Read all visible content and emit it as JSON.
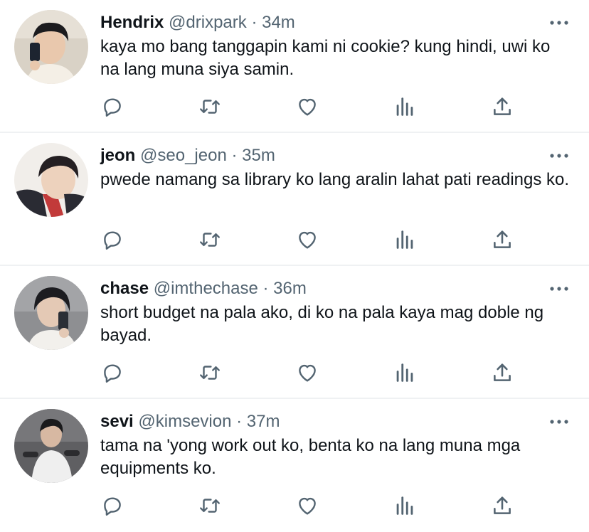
{
  "tweets": [
    {
      "name": "Hendrix",
      "handle": "@drixpark",
      "separator": "·",
      "time": "34m",
      "text": "kaya mo bang tanggapin kami ni cookie? kung hindi, uwi ko na lang muna siya samin."
    },
    {
      "name": "jeon",
      "handle": "@seo_jeon",
      "separator": "·",
      "time": "35m",
      "text": "pwede namang sa library ko lang aralin lahat pati readings ko."
    },
    {
      "name": "chase",
      "handle": "@imthechase",
      "separator": "·",
      "time": "36m",
      "text": "short budget na pala ako, di ko na pala kaya mag doble ng bayad."
    },
    {
      "name": "sevi",
      "handle": "@kimsevion",
      "separator": "·",
      "time": "37m",
      "text": "tama na 'yong work out ko, benta ko na lang muna mga equipments ko."
    }
  ],
  "icons": {
    "more": "more-horizontal-icon",
    "reply": "reply-icon",
    "retweet": "retweet-icon",
    "like": "heart-icon",
    "views": "views-chart-icon",
    "share": "share-icon"
  },
  "colors": {
    "text": "#0f1419",
    "secondary": "#536471",
    "divider": "#eff1f3"
  }
}
